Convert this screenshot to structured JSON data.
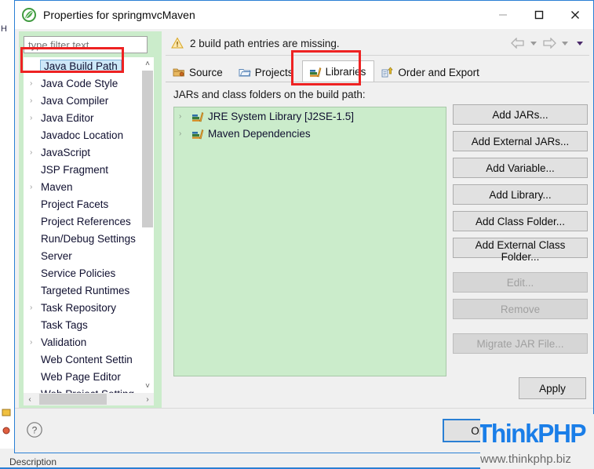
{
  "ide": {
    "left_strip_chars": "H",
    "description_label": "Description"
  },
  "window": {
    "title": "Properties for springmvcMaven",
    "app_icon": "eclipse-logo-icon",
    "minimize_label": "—",
    "maximize_label": "□",
    "close_label": "✕"
  },
  "message_bar": {
    "icon": "warning-icon",
    "text": "2 build path entries are missing.",
    "nav_back": "back-arrow-icon",
    "nav_forward": "forward-arrow-icon"
  },
  "sidebar": {
    "filter": {
      "value": "",
      "placeholder": "type filter text"
    },
    "items": [
      {
        "label": "Java Build Path",
        "expandable": false,
        "selected": true
      },
      {
        "label": "Java Code Style",
        "expandable": true,
        "selected": false
      },
      {
        "label": "Java Compiler",
        "expandable": true,
        "selected": false
      },
      {
        "label": "Java Editor",
        "expandable": true,
        "selected": false
      },
      {
        "label": "Javadoc Location",
        "expandable": false,
        "selected": false
      },
      {
        "label": "JavaScript",
        "expandable": true,
        "selected": false
      },
      {
        "label": "JSP Fragment",
        "expandable": false,
        "selected": false
      },
      {
        "label": "Maven",
        "expandable": true,
        "selected": false
      },
      {
        "label": "Project Facets",
        "expandable": false,
        "selected": false
      },
      {
        "label": "Project References",
        "expandable": false,
        "selected": false
      },
      {
        "label": "Run/Debug Settings",
        "expandable": false,
        "selected": false
      },
      {
        "label": "Server",
        "expandable": false,
        "selected": false
      },
      {
        "label": "Service Policies",
        "expandable": false,
        "selected": false
      },
      {
        "label": "Targeted Runtimes",
        "expandable": false,
        "selected": false
      },
      {
        "label": "Task Repository",
        "expandable": true,
        "selected": false
      },
      {
        "label": "Task Tags",
        "expandable": false,
        "selected": false
      },
      {
        "label": "Validation",
        "expandable": true,
        "selected": false
      },
      {
        "label": "Web Content Settin",
        "expandable": false,
        "selected": false
      },
      {
        "label": "Web Page Editor",
        "expandable": false,
        "selected": false
      },
      {
        "label": "Web Project Setting",
        "expandable": false,
        "selected": false
      }
    ],
    "scroll_up": "˄",
    "scroll_down": "˅",
    "hscroll_left": "‹",
    "hscroll_right": "›"
  },
  "tabs": [
    {
      "label": "Source",
      "icon": "source-folder-icon",
      "active": false
    },
    {
      "label": "Projects",
      "icon": "projects-folder-icon",
      "active": false
    },
    {
      "label": "Libraries",
      "icon": "libraries-books-icon",
      "active": true
    },
    {
      "label": "Order and Export",
      "icon": "order-export-icon",
      "active": false
    }
  ],
  "main": {
    "list_label": "JARs and class folders on the build path:",
    "libraries": [
      {
        "label": "JRE System Library [J2SE-1.5]",
        "icon": "library-books-icon"
      },
      {
        "label": "Maven Dependencies",
        "icon": "library-books-icon"
      }
    ],
    "buttons": [
      {
        "label": "Add JARs...",
        "enabled": true
      },
      {
        "label": "Add External JARs...",
        "enabled": true
      },
      {
        "label": "Add Variable...",
        "enabled": true
      },
      {
        "label": "Add Library...",
        "enabled": true
      },
      {
        "label": "Add Class Folder...",
        "enabled": true
      },
      {
        "label": "Add External Class Folder...",
        "enabled": true
      },
      {
        "label": "Edit...",
        "enabled": false
      },
      {
        "label": "Remove",
        "enabled": false
      },
      {
        "label": "Migrate JAR File...",
        "enabled": false
      }
    ],
    "apply_label": "Apply"
  },
  "footer": {
    "help_icon": "help-question-icon",
    "ok_label": "OK"
  },
  "watermark": {
    "brand": "ThinkPHP",
    "url": "www.thinkphp.biz"
  },
  "colors": {
    "accent_blue": "#2a7fd4",
    "annotation_red": "#ee2222",
    "highlight_green": "#cbeccb",
    "selection_blue": "#cde8f8",
    "brand_blue": "#1a7ee8"
  }
}
